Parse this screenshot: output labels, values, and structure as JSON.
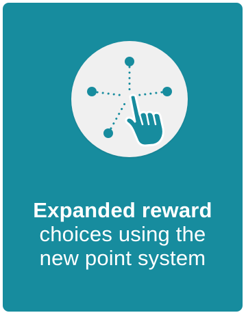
{
  "card": {
    "headline": "Expanded reward",
    "line2": "choices using the",
    "line3": "new point system",
    "accent_color": "#178c9e",
    "circle_color": "#f0f0f0"
  },
  "icon": {
    "name": "hand-pointer-network-icon"
  }
}
